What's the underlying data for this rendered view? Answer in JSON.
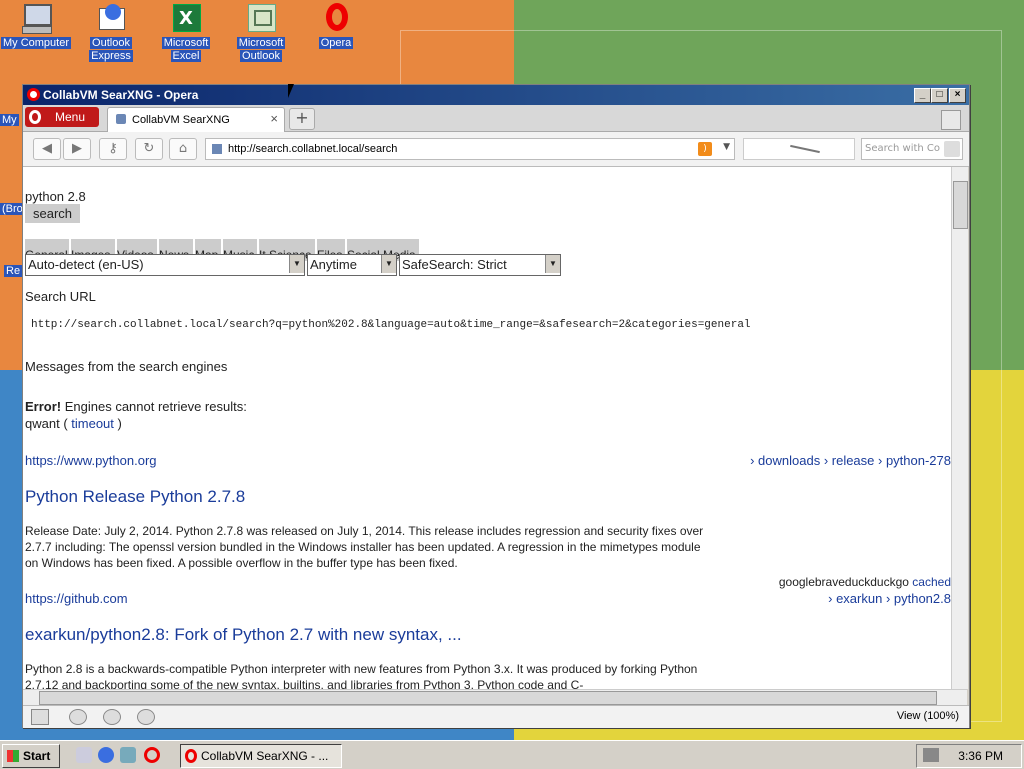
{
  "desktop": {
    "icons": [
      {
        "label1": "My Computer",
        "label2": ""
      },
      {
        "label1": "Outlook",
        "label2": "Express"
      },
      {
        "label1": "Microsoft",
        "label2": "Excel"
      },
      {
        "label1": "Microsoft",
        "label2": "Outlook"
      },
      {
        "label1": "Opera",
        "label2": ""
      }
    ],
    "left_edge_labels": [
      "My",
      "(Bro",
      "Re"
    ]
  },
  "window": {
    "title": "CollabVM SearXNG - Opera",
    "controls": {
      "minimize": "_",
      "maximize": "□",
      "close": "×"
    }
  },
  "browser": {
    "menu_label": "Menu",
    "tab_title": "CollabVM SearXNG",
    "tab_close": "×",
    "new_tab": "+",
    "address": "http://search.collabnet.local/search",
    "search_placeholder": "Search with Co",
    "nav_icons": [
      "back-icon",
      "forward-icon",
      "key-icon",
      "reload-icon",
      "home-icon"
    ]
  },
  "page": {
    "query": "python 2.8",
    "search_button": "search",
    "categories": [
      "General",
      "Images",
      "Videos",
      "News",
      "Map",
      "Music",
      "It",
      "Science",
      "Files",
      "Social Media"
    ],
    "language_select": "Auto-detect (en-US)",
    "time_select": "Anytime",
    "safesearch_select": "SafeSearch: Strict",
    "search_url_heading": "Search URL",
    "search_url": "http://search.collabnet.local/search?q=python%202.8&language=auto&time_range=&safesearch=2&categories=general",
    "messages_heading": "Messages from the search engines",
    "error_label": "Error!",
    "error_text": " Engines cannot retrieve results:",
    "engine_name": "qwant",
    "engine_open": " ( ",
    "engine_error": "timeout",
    "engine_close": " )",
    "results": [
      {
        "url": "https://www.python.org",
        "breadcrumb": "› downloads › release › python-278",
        "title": "Python Release Python 2.7.8",
        "desc": "Release Date: July 2, 2014. Python 2.7.8 was released on July 1, 2014. This release includes regression and security fixes over 2.7.7 including: The openssl version bundled in the Windows installer has been updated. A regression in the mimetypes module on Windows has been fixed. A possible overflow in the buffer type has been fixed."
      },
      {
        "engines": "googlebraveduckduckgo",
        "cached": "cached",
        "url": "https://github.com",
        "breadcrumb": "› exarkun › python2.8",
        "title": "exarkun/python2.8: Fork of Python 2.7 with new syntax, ...",
        "desc": "Python 2.8 is a backwards-compatible Python interpreter with new features from Python 3.x. It was produced by forking Python 2.7.12 and backporting some of the new syntax, builtins, and libraries from Python 3. Python code and C-"
      }
    ]
  },
  "status": {
    "zoom": "View (100%)"
  },
  "taskbar": {
    "start": "Start",
    "task": "CollabVM SearXNG - ...",
    "clock": "3:36 PM"
  }
}
